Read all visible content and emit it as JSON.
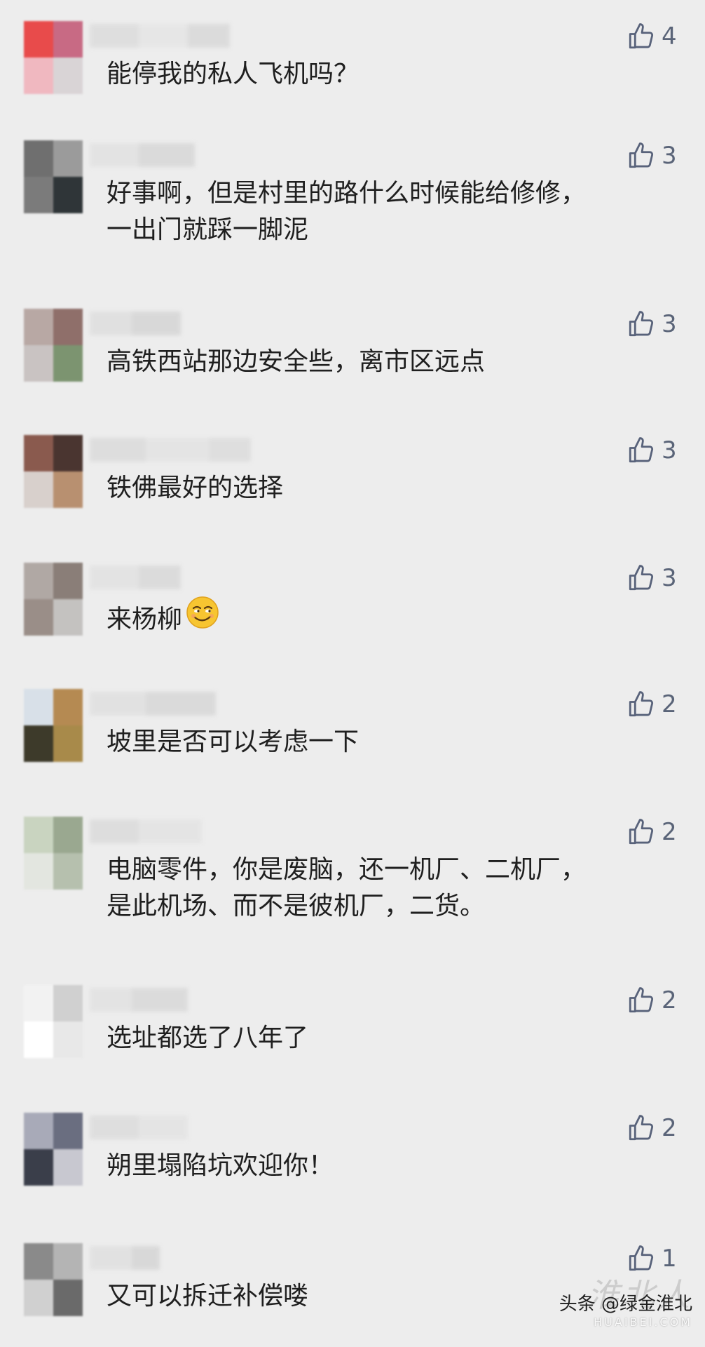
{
  "comments": [
    {
      "text": "能停我的私人飞机吗？",
      "likes": "4",
      "avatar_colors": [
        "#e84b4b",
        "#c86a84",
        "#f0b8c0",
        "#d9d4d6"
      ]
    },
    {
      "text": "好事啊，但是村里的路什么时候能给修修，\n一出门就踩一脚泥",
      "likes": "3",
      "avatar_colors": [
        "#6f6f6f",
        "#9b9b9b",
        "#2f3538",
        "#7b7b7b"
      ]
    },
    {
      "text": "高铁西站那边安全些，离市区远点",
      "likes": "3",
      "avatar_colors": [
        "#b8a8a4",
        "#8f6f6a",
        "#7c9470",
        "#c9c3c2"
      ]
    },
    {
      "text": "铁佛最好的选择",
      "likes": "3",
      "avatar_colors": [
        "#8a5a4e",
        "#4a3530",
        "#b89070",
        "#d8d0cc"
      ]
    },
    {
      "text": "来杨柳",
      "likes": "3",
      "avatar_colors": [
        "#b0a8a4",
        "#8a7e78",
        "#c4c2c0",
        "#9a8e88"
      ]
    },
    {
      "text": "坡里是否可以考虑一下",
      "likes": "2",
      "avatar_colors": [
        "#d8e0e8",
        "#b58a52",
        "#3d3a2a",
        "#a88a4a"
      ]
    },
    {
      "text": "电脑零件，你是废脑，还一机厂、二机厂，\n是此机场、而不是彼机厂，二货。",
      "likes": "2",
      "avatar_colors": [
        "#c9d4c0",
        "#9aa890",
        "#e3e6e0",
        "#b6c0ae"
      ]
    },
    {
      "text": "选址都选了八年了",
      "likes": "2",
      "avatar_colors": [
        "#f2f2f2",
        "#d0d0d0",
        "#e8e8e8",
        "#ffffff"
      ]
    },
    {
      "text": "朔里塌陷坑欢迎你！",
      "likes": "2",
      "avatar_colors": [
        "#a8aab8",
        "#3a3e4a",
        "#6a6e80",
        "#c8c8d0"
      ]
    },
    {
      "text": "又可以拆迁补偿喽",
      "likes": "1",
      "avatar_colors": [
        "#8a8a8a",
        "#b4b4b4",
        "#6a6a6a",
        "#d0d0d0"
      ]
    }
  ],
  "watermark": {
    "label": "头条 @绿金淮北",
    "site": "HUAIBEI.COM",
    "overlay": "淮北人"
  },
  "colors": {
    "background": "#ededed",
    "like_icon": "#58627a",
    "text": "#1f1f1f"
  },
  "icons": {
    "like": "thumbs-up-icon",
    "emoji": "smirk-emoji-icon"
  }
}
